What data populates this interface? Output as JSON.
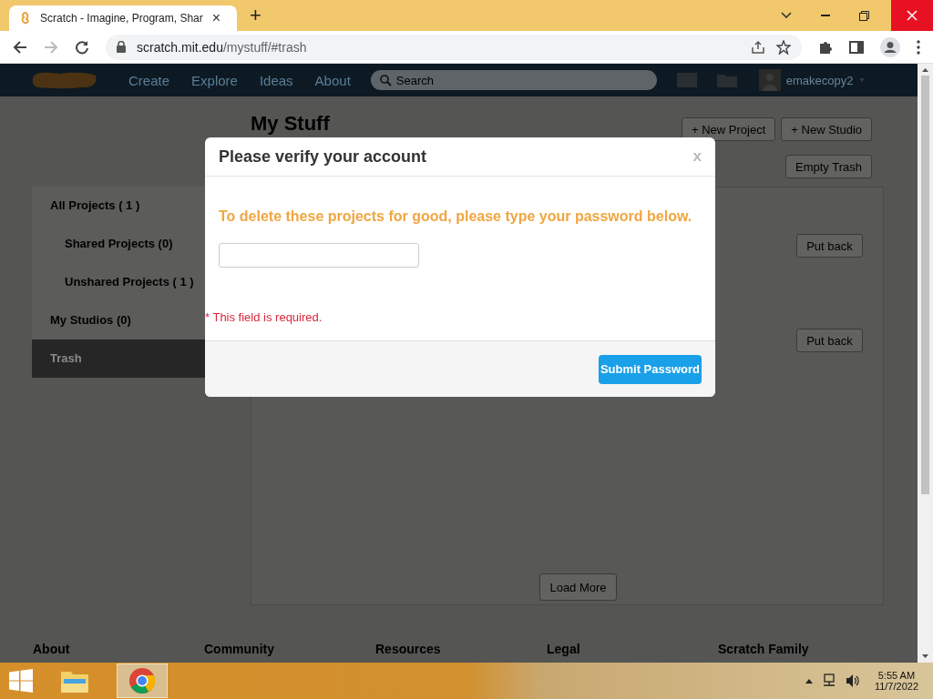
{
  "browser": {
    "tab": {
      "title": "Scratch - Imagine, Program, Shar",
      "close": "×"
    },
    "new_tab": "+",
    "address": {
      "host": "scratch.mit.edu",
      "path": "/mystuff/#trash"
    }
  },
  "navbar": {
    "links": [
      "Create",
      "Explore",
      "Ideas",
      "About"
    ],
    "search": {
      "placeholder": "Search"
    },
    "username": "emakecopy2"
  },
  "page": {
    "heading": "My Stuff",
    "buttons": [
      "+ New Project",
      "+ New Studio"
    ],
    "empty_trash": "Empty Trash",
    "sidebar": [
      {
        "label": "All Projects ( 1 )",
        "selected": false,
        "children": [
          {
            "label": "Shared Projects (0)",
            "selected": false
          },
          {
            "label": "Unshared Projects ( 1 )",
            "selected": false
          }
        ]
      },
      {
        "label": "My Studios (0)",
        "selected": false
      },
      {
        "label": "Trash",
        "selected": true
      }
    ],
    "projects": [
      {
        "action": "Put back"
      },
      {
        "action": "Put back"
      }
    ],
    "load_more": "Load More"
  },
  "footer": [
    "About",
    "Community",
    "Resources",
    "Legal",
    "Scratch Family"
  ],
  "modal": {
    "title": "Please verify your account",
    "close": "x",
    "message": "To delete these projects for good, please type your password below.",
    "error": "* This field is required.",
    "submit": "Submit Password"
  },
  "taskbar": {
    "time": "5:55 AM",
    "date": "11/7/2022"
  }
}
